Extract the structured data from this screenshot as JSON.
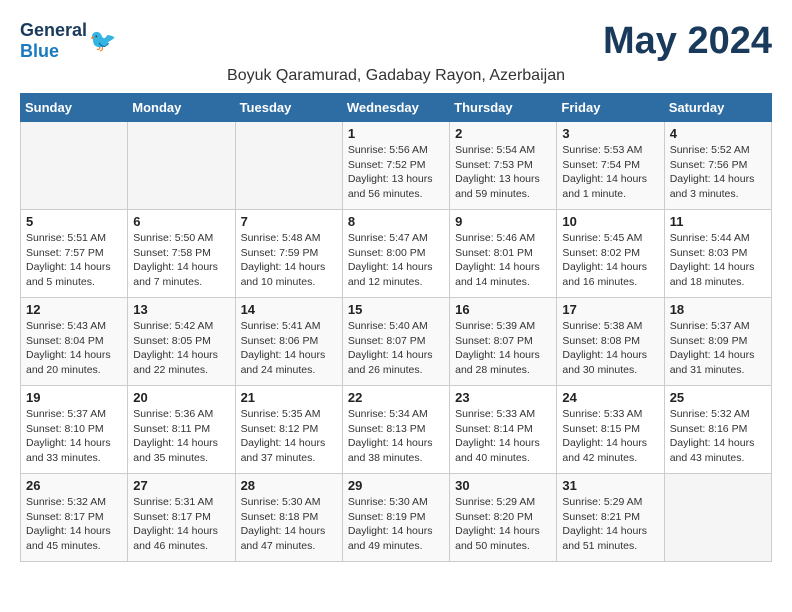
{
  "header": {
    "logo_general": "General",
    "logo_blue": "Blue",
    "month_title": "May 2024",
    "location": "Boyuk Qaramurad, Gadabay Rayon, Azerbaijan"
  },
  "weekdays": [
    "Sunday",
    "Monday",
    "Tuesday",
    "Wednesday",
    "Thursday",
    "Friday",
    "Saturday"
  ],
  "weeks": [
    [
      {
        "day": "",
        "detail": ""
      },
      {
        "day": "",
        "detail": ""
      },
      {
        "day": "",
        "detail": ""
      },
      {
        "day": "1",
        "detail": "Sunrise: 5:56 AM\nSunset: 7:52 PM\nDaylight: 13 hours and 56 minutes."
      },
      {
        "day": "2",
        "detail": "Sunrise: 5:54 AM\nSunset: 7:53 PM\nDaylight: 13 hours and 59 minutes."
      },
      {
        "day": "3",
        "detail": "Sunrise: 5:53 AM\nSunset: 7:54 PM\nDaylight: 14 hours and 1 minute."
      },
      {
        "day": "4",
        "detail": "Sunrise: 5:52 AM\nSunset: 7:56 PM\nDaylight: 14 hours and 3 minutes."
      }
    ],
    [
      {
        "day": "5",
        "detail": "Sunrise: 5:51 AM\nSunset: 7:57 PM\nDaylight: 14 hours and 5 minutes."
      },
      {
        "day": "6",
        "detail": "Sunrise: 5:50 AM\nSunset: 7:58 PM\nDaylight: 14 hours and 7 minutes."
      },
      {
        "day": "7",
        "detail": "Sunrise: 5:48 AM\nSunset: 7:59 PM\nDaylight: 14 hours and 10 minutes."
      },
      {
        "day": "8",
        "detail": "Sunrise: 5:47 AM\nSunset: 8:00 PM\nDaylight: 14 hours and 12 minutes."
      },
      {
        "day": "9",
        "detail": "Sunrise: 5:46 AM\nSunset: 8:01 PM\nDaylight: 14 hours and 14 minutes."
      },
      {
        "day": "10",
        "detail": "Sunrise: 5:45 AM\nSunset: 8:02 PM\nDaylight: 14 hours and 16 minutes."
      },
      {
        "day": "11",
        "detail": "Sunrise: 5:44 AM\nSunset: 8:03 PM\nDaylight: 14 hours and 18 minutes."
      }
    ],
    [
      {
        "day": "12",
        "detail": "Sunrise: 5:43 AM\nSunset: 8:04 PM\nDaylight: 14 hours and 20 minutes."
      },
      {
        "day": "13",
        "detail": "Sunrise: 5:42 AM\nSunset: 8:05 PM\nDaylight: 14 hours and 22 minutes."
      },
      {
        "day": "14",
        "detail": "Sunrise: 5:41 AM\nSunset: 8:06 PM\nDaylight: 14 hours and 24 minutes."
      },
      {
        "day": "15",
        "detail": "Sunrise: 5:40 AM\nSunset: 8:07 PM\nDaylight: 14 hours and 26 minutes."
      },
      {
        "day": "16",
        "detail": "Sunrise: 5:39 AM\nSunset: 8:07 PM\nDaylight: 14 hours and 28 minutes."
      },
      {
        "day": "17",
        "detail": "Sunrise: 5:38 AM\nSunset: 8:08 PM\nDaylight: 14 hours and 30 minutes."
      },
      {
        "day": "18",
        "detail": "Sunrise: 5:37 AM\nSunset: 8:09 PM\nDaylight: 14 hours and 31 minutes."
      }
    ],
    [
      {
        "day": "19",
        "detail": "Sunrise: 5:37 AM\nSunset: 8:10 PM\nDaylight: 14 hours and 33 minutes."
      },
      {
        "day": "20",
        "detail": "Sunrise: 5:36 AM\nSunset: 8:11 PM\nDaylight: 14 hours and 35 minutes."
      },
      {
        "day": "21",
        "detail": "Sunrise: 5:35 AM\nSunset: 8:12 PM\nDaylight: 14 hours and 37 minutes."
      },
      {
        "day": "22",
        "detail": "Sunrise: 5:34 AM\nSunset: 8:13 PM\nDaylight: 14 hours and 38 minutes."
      },
      {
        "day": "23",
        "detail": "Sunrise: 5:33 AM\nSunset: 8:14 PM\nDaylight: 14 hours and 40 minutes."
      },
      {
        "day": "24",
        "detail": "Sunrise: 5:33 AM\nSunset: 8:15 PM\nDaylight: 14 hours and 42 minutes."
      },
      {
        "day": "25",
        "detail": "Sunrise: 5:32 AM\nSunset: 8:16 PM\nDaylight: 14 hours and 43 minutes."
      }
    ],
    [
      {
        "day": "26",
        "detail": "Sunrise: 5:32 AM\nSunset: 8:17 PM\nDaylight: 14 hours and 45 minutes."
      },
      {
        "day": "27",
        "detail": "Sunrise: 5:31 AM\nSunset: 8:17 PM\nDaylight: 14 hours and 46 minutes."
      },
      {
        "day": "28",
        "detail": "Sunrise: 5:30 AM\nSunset: 8:18 PM\nDaylight: 14 hours and 47 minutes."
      },
      {
        "day": "29",
        "detail": "Sunrise: 5:30 AM\nSunset: 8:19 PM\nDaylight: 14 hours and 49 minutes."
      },
      {
        "day": "30",
        "detail": "Sunrise: 5:29 AM\nSunset: 8:20 PM\nDaylight: 14 hours and 50 minutes."
      },
      {
        "day": "31",
        "detail": "Sunrise: 5:29 AM\nSunset: 8:21 PM\nDaylight: 14 hours and 51 minutes."
      },
      {
        "day": "",
        "detail": ""
      }
    ]
  ]
}
